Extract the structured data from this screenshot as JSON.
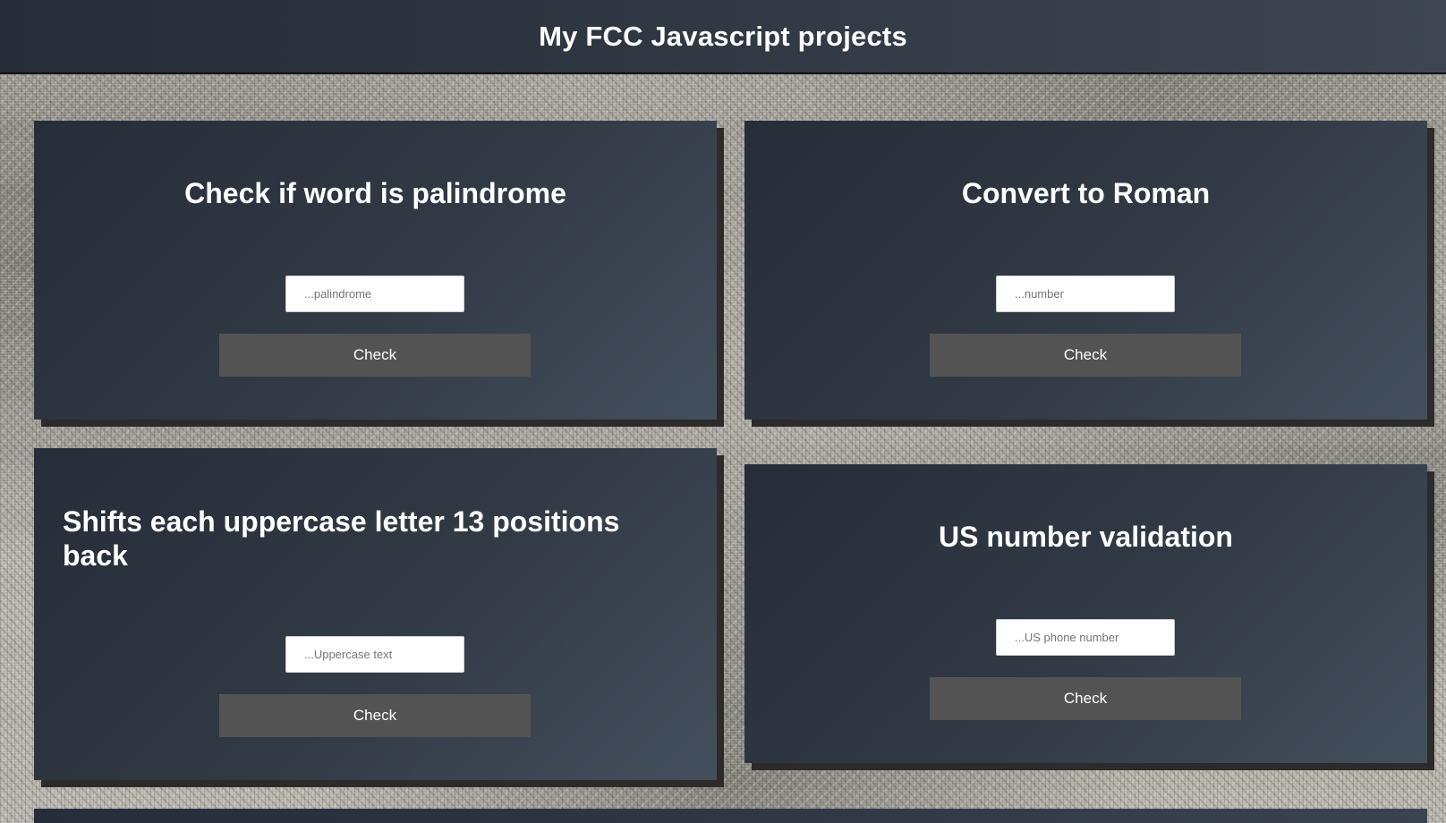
{
  "page": {
    "title": "My FCC Javascript projects"
  },
  "projects": [
    {
      "title": "Check if word is palindrome",
      "placeholder": "...palindrome",
      "button_label": "Check"
    },
    {
      "title": "Convert to Roman",
      "placeholder": "...number",
      "button_label": "Check"
    },
    {
      "title": "Shifts each uppercase letter 13 positions back",
      "placeholder": "...Uppercase text",
      "button_label": "Check"
    },
    {
      "title": "US number validation",
      "placeholder": "...US phone number",
      "button_label": "Check"
    }
  ],
  "colors": {
    "header_bg": "#2f3743",
    "card_bg": "#323a46",
    "button_bg": "#535353",
    "text": "#ffffff"
  }
}
